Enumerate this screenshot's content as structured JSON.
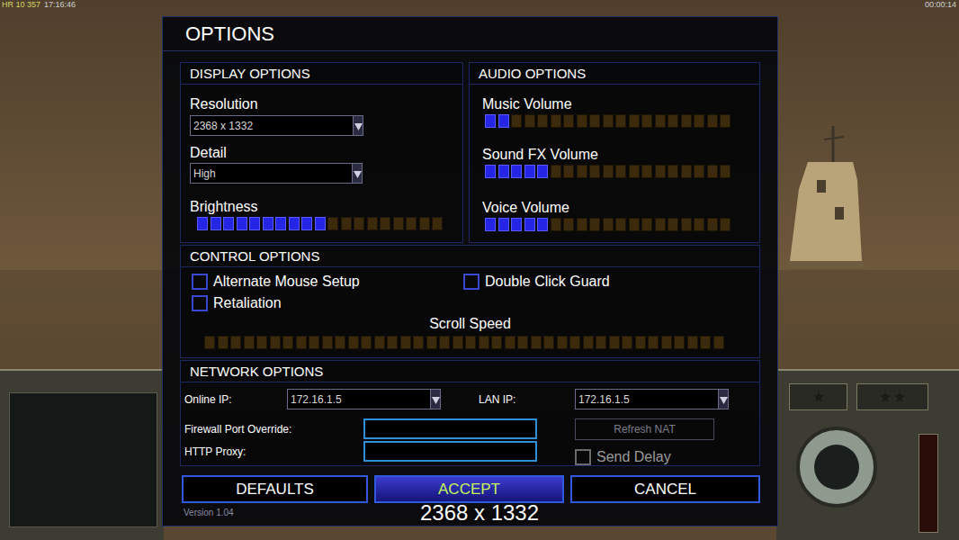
{
  "hud": {
    "top_left": "HR 10 357",
    "clock": "17:16:46",
    "timer": "00:00:14"
  },
  "dialog": {
    "title": "OPTIONS",
    "version": "Version 1.04"
  },
  "display": {
    "title": "DISPLAY OPTIONS",
    "resolution": {
      "label": "Resolution",
      "value": "2368 x 1332"
    },
    "detail": {
      "label": "Detail",
      "value": "High"
    },
    "brightness": {
      "label": "Brightness",
      "level": 0.53
    }
  },
  "audio": {
    "title": "AUDIO OPTIONS",
    "sliders": [
      {
        "label": "Music Volume",
        "level": 0.1
      },
      {
        "label": "Sound FX Volume",
        "level": 0.26
      },
      {
        "label": "Voice Volume",
        "level": 0.26
      }
    ]
  },
  "controls": {
    "title": "CONTROL OPTIONS",
    "checkboxes": [
      {
        "label": "Alternate Mouse Setup",
        "checked": false
      },
      {
        "label": "Double Click Guard",
        "checked": false
      },
      {
        "label": "Retaliation",
        "checked": false
      }
    ],
    "scroll_speed": {
      "label": "Scroll Speed",
      "level": 0
    }
  },
  "network": {
    "title": "NETWORK OPTIONS",
    "online_ip": {
      "label": "Online IP:",
      "value": "172.16.1.5"
    },
    "lan_ip": {
      "label": "LAN IP:",
      "value": "172.16.1.5"
    },
    "firewall_port": {
      "label": "Firewall Port Override:",
      "value": ""
    },
    "http_proxy": {
      "label": "HTTP Proxy:",
      "value": ""
    },
    "refresh_nat": {
      "label": "Refresh NAT",
      "disabled": true
    },
    "send_delay": {
      "label": "Send Delay",
      "checked": false,
      "disabled": true
    }
  },
  "buttons": [
    {
      "label": "DEFAULTS",
      "selected": false
    },
    {
      "label": "ACCEPT",
      "selected": true
    },
    {
      "label": "CANCEL",
      "selected": false
    }
  ],
  "overlay": "2368 x 1332"
}
